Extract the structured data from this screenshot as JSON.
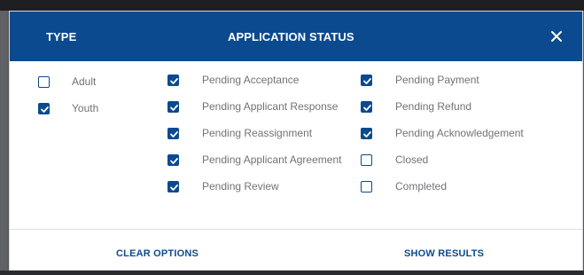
{
  "header": {
    "type_label": "TYPE",
    "status_label": "APPLICATION STATUS",
    "close_icon": "close-icon"
  },
  "type_options": [
    {
      "label": "Adult",
      "checked": false
    },
    {
      "label": "Youth",
      "checked": true
    }
  ],
  "status_options_col1": [
    {
      "label": "Pending Acceptance",
      "checked": true
    },
    {
      "label": "Pending Applicant Response",
      "checked": true
    },
    {
      "label": "Pending Reassignment",
      "checked": true
    },
    {
      "label": "Pending Applicant Agreement",
      "checked": true
    },
    {
      "label": "Pending Review",
      "checked": true
    }
  ],
  "status_options_col2": [
    {
      "label": "Pending Payment",
      "checked": true
    },
    {
      "label": "Pending Refund",
      "checked": true
    },
    {
      "label": "Pending Acknowledgement",
      "checked": true
    },
    {
      "label": "Closed",
      "checked": false
    },
    {
      "label": "Completed",
      "checked": false
    }
  ],
  "footer": {
    "clear_label": "CLEAR OPTIONS",
    "show_label": "SHOW RESULTS"
  },
  "colors": {
    "accent": "#0b4a8f",
    "label_text": "#6f7377"
  }
}
